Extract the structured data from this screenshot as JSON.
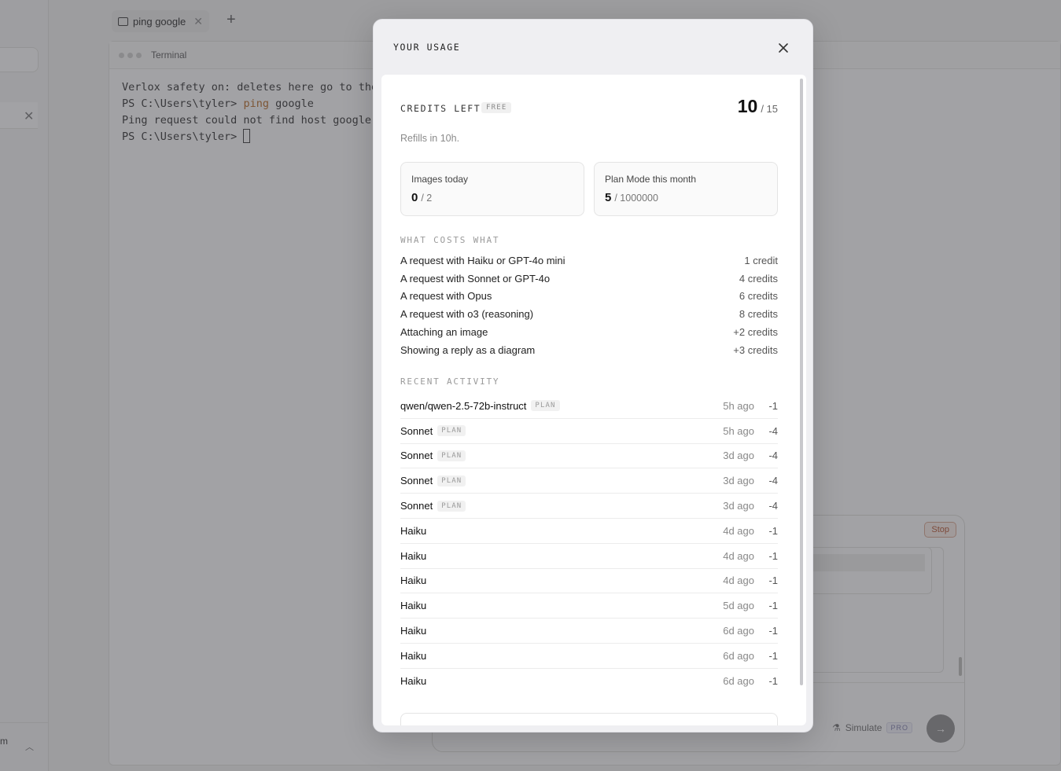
{
  "background": {
    "sidebar": {
      "bottom_label": "m"
    },
    "tab": {
      "label": "ping google"
    },
    "terminal": {
      "title": "Terminal",
      "lines": [
        {
          "text": "Verlox safety on: deletes here go to the"
        },
        {
          "prompt": "PS C:\\Users\\tyler> ",
          "command": "ping",
          "args": " google"
        },
        {
          "text": "Ping request could not find host google."
        },
        {
          "prompt": "PS C:\\Users\\tyler> "
        }
      ]
    },
    "chat": {
      "stop_label": "Stop",
      "simulate_label": "Simulate",
      "pro_badge": "PRO"
    }
  },
  "modal": {
    "title": "YOUR USAGE",
    "credits": {
      "label": "CREDITS LEFT",
      "plan_badge": "FREE",
      "remaining": "10",
      "total": "/ 15",
      "refill_text": "Refills in 10h."
    },
    "stats": [
      {
        "label": "Images today",
        "value": "0",
        "limit": "/ 2"
      },
      {
        "label": "Plan Mode this month",
        "value": "5",
        "limit": "/ 1000000"
      }
    ],
    "costs_title": "WHAT COSTS WHAT",
    "costs": [
      {
        "label": "A request with Haiku or GPT-4o mini",
        "value": "1 credit"
      },
      {
        "label": "A request with Sonnet or GPT-4o",
        "value": "4 credits"
      },
      {
        "label": "A request with Opus",
        "value": "6 credits"
      },
      {
        "label": "A request with o3 (reasoning)",
        "value": "8 credits"
      },
      {
        "label": "Attaching an image",
        "value": "+2 credits"
      },
      {
        "label": "Showing a reply as a diagram",
        "value": "+3 credits"
      }
    ],
    "activity_title": "RECENT ACTIVITY",
    "activity": [
      {
        "model": "qwen/qwen-2.5-72b-instruct",
        "badge": "PLAN",
        "time": "5h ago",
        "delta": "-1"
      },
      {
        "model": "Sonnet",
        "badge": "PLAN",
        "time": "5h ago",
        "delta": "-4"
      },
      {
        "model": "Sonnet",
        "badge": "PLAN",
        "time": "3d ago",
        "delta": "-4"
      },
      {
        "model": "Sonnet",
        "badge": "PLAN",
        "time": "3d ago",
        "delta": "-4"
      },
      {
        "model": "Sonnet",
        "badge": "PLAN",
        "time": "3d ago",
        "delta": "-4"
      },
      {
        "model": "Haiku",
        "badge": "",
        "time": "4d ago",
        "delta": "-1"
      },
      {
        "model": "Haiku",
        "badge": "",
        "time": "4d ago",
        "delta": "-1"
      },
      {
        "model": "Haiku",
        "badge": "",
        "time": "4d ago",
        "delta": "-1"
      },
      {
        "model": "Haiku",
        "badge": "",
        "time": "5d ago",
        "delta": "-1"
      },
      {
        "model": "Haiku",
        "badge": "",
        "time": "6d ago",
        "delta": "-1"
      },
      {
        "model": "Haiku",
        "badge": "",
        "time": "6d ago",
        "delta": "-1"
      },
      {
        "model": "Haiku",
        "badge": "",
        "time": "6d ago",
        "delta": "-1"
      }
    ]
  }
}
